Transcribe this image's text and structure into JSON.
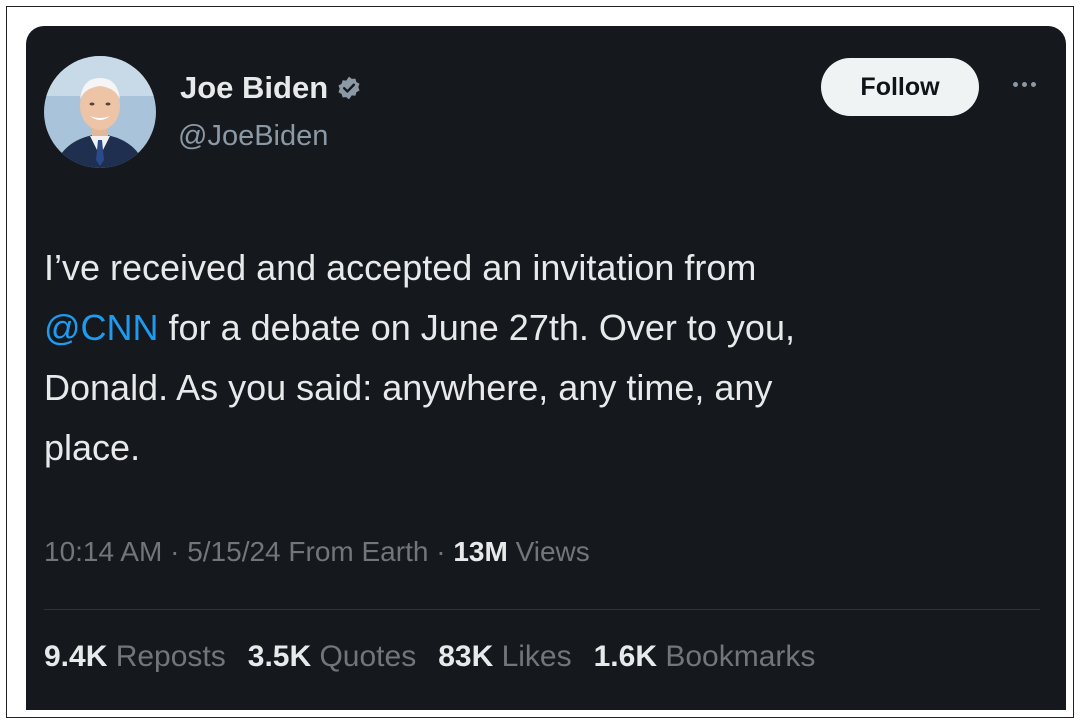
{
  "author": {
    "name": "Joe Biden",
    "handle": "@JoeBiden",
    "verified_color": "#8b98a5"
  },
  "actions": {
    "follow_label": "Follow",
    "more_icon": "more-horizontal-icon"
  },
  "tweet": {
    "line1": "I’ve received and accepted an invitation from",
    "mention": "@CNN",
    "line2_rest": " for a debate on June 27th. Over to you,",
    "line3": "Donald. As you said: anywhere, any time, any",
    "line4": "place."
  },
  "meta": {
    "time": "10:14 AM",
    "sep1": " · ",
    "date": "5/15/24",
    "source": " From Earth",
    "sep2": " · ",
    "views_count": "13M",
    "views_label": " Views"
  },
  "stats": [
    {
      "value": "9.4K",
      "label": " Reposts"
    },
    {
      "value": "3.5K",
      "label": " Quotes"
    },
    {
      "value": "83K",
      "label": " Likes"
    },
    {
      "value": "1.6K",
      "label": " Bookmarks"
    }
  ],
  "colors": {
    "background": "#15181c",
    "text": "#e7e9ea",
    "muted": "#71767b",
    "link": "#1d9bf0"
  }
}
